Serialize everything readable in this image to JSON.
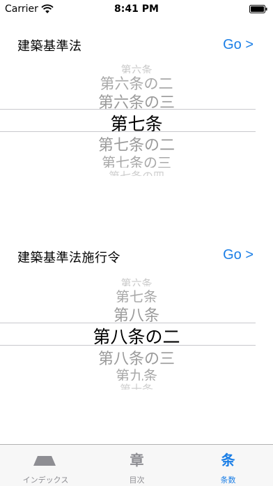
{
  "status_bar": {
    "carrier": "Carrier",
    "time": "8:41 PM"
  },
  "sections": [
    {
      "title": "建築基準法",
      "go_label": "Go >",
      "picker": {
        "items": [
          "第六条",
          "第六条の二",
          "第六条の三",
          "第七条",
          "第七条の二",
          "第七条の三",
          "第七条の四"
        ],
        "selected": "第七条"
      }
    },
    {
      "title": "建築基準法施行令",
      "go_label": "Go >",
      "picker": {
        "items": [
          "第六条",
          "第七条",
          "第八条",
          "第八条の二",
          "第八条の三",
          "第九条",
          "第十条"
        ],
        "selected": "第八条の二"
      }
    }
  ],
  "tab_bar": {
    "tabs": [
      {
        "label": "インデックス",
        "icon": "index-tray-icon",
        "active": false
      },
      {
        "label": "目次",
        "icon": "chapter-icon",
        "icon_text": "章",
        "active": false
      },
      {
        "label": "条数",
        "icon": "article-icon",
        "icon_text": "条",
        "active": true
      }
    ]
  }
}
